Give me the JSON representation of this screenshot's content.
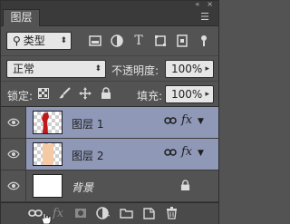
{
  "panel": {
    "tab_label": "图层",
    "menu_icon": "panel-menu-icon"
  },
  "filter": {
    "kind_label": "类型",
    "icons": [
      "image-filter-icon",
      "adjustment-filter-icon",
      "text-filter-icon",
      "shape-filter-icon",
      "smart-object-filter-icon",
      "toggle-filter-icon"
    ]
  },
  "blend": {
    "mode": "正常",
    "opacity_label": "不透明度:",
    "opacity_value": "100%"
  },
  "lock": {
    "label": "锁定:",
    "fill_label": "填充:",
    "fill_value": "100%"
  },
  "layers": [
    {
      "name": "图层 1",
      "selected": true,
      "linked": true,
      "has_fx": true
    },
    {
      "name": "图层 2",
      "selected": true,
      "linked": true,
      "has_fx": true
    },
    {
      "name": "背景",
      "selected": false,
      "locked": true
    }
  ],
  "bottom_bar": {
    "icons": [
      "link-layers-icon",
      "add-style-icon",
      "add-mask-icon",
      "new-adjustment-icon",
      "new-group-icon",
      "new-layer-icon",
      "delete-layer-icon"
    ]
  },
  "colors": {
    "panel_bg": "#535353",
    "selected_row": "#8f98b7",
    "thumb_red": "#c0191b"
  }
}
